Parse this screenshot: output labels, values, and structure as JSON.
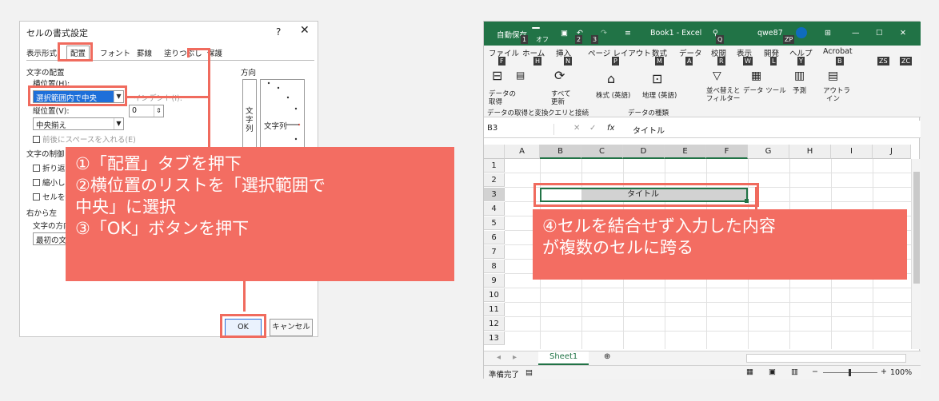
{
  "dialog": {
    "title": "セルの書式設定",
    "help": "?",
    "close": "✕",
    "tabs": [
      "表示形式",
      "配置",
      "フォント",
      "罫線",
      "塗りつぶし",
      "保護"
    ],
    "text_alignment": "文字の配置",
    "horizontal_label": "横位置(H):",
    "horizontal_value": "選択範囲内で中央",
    "indent_label": "インデント(I):",
    "indent_value": "0",
    "vertical_label": "縦位置(V):",
    "vertical_value": "中央揃え",
    "distributed_label": "前後にスペースを入れる(E)",
    "text_control": "文字の制御",
    "wrap": "折り返し",
    "shrink": "縮小して",
    "merge": "セルを結",
    "rtl": "右から左",
    "direction_label": "文字の方向",
    "direction_value": "最初の文字",
    "orientation": "方向",
    "vertical_text": [
      "文",
      "字",
      "列"
    ],
    "orient_text": "文字列",
    "ok": "OK",
    "cancel": "キャンセル"
  },
  "callout_left": {
    "lines": [
      "①「配置」タブを押下",
      "②横位置のリストを「選択範囲で",
      "中央」に選択",
      "③「OK」ボタンを押下"
    ]
  },
  "callout_right": {
    "lines": [
      "④セルを結合せず入力した内容",
      "が複数のセルに跨る"
    ]
  },
  "excel": {
    "autosave": "自動保存",
    "autosave_state": "オフ",
    "title": "Book1  -  Excel",
    "user": "qwe87",
    "keytips": {
      "k1": "1",
      "k2": "2",
      "k3": "3",
      "q": "Q",
      "zp": "ZP",
      "f": "F",
      "h": "H",
      "n": "N",
      "p": "P",
      "m": "M",
      "a": "A",
      "r": "R",
      "w": "W",
      "l": "L",
      "y": "Y",
      "b": "B",
      "zs": "ZS",
      "zc": "ZC"
    },
    "menu": [
      "ファイル",
      "ホーム",
      "挿入",
      "ページ レイアウト",
      "数式",
      "データ",
      "校閲",
      "表示",
      "開発",
      "ヘルプ",
      "Acrobat"
    ],
    "ribbon": {
      "get_data": "データの",
      "get_data2": "取得",
      "refresh": "すべて",
      "refresh2": "更新",
      "stocks": "株式 (英語)",
      "geo": "地理 (英語)",
      "sort": "並べ替えと",
      "sort2": "フィルター",
      "data_tools": "データ ツール",
      "forecast": "予測",
      "outline": "アウトラ",
      "outline2": "イン",
      "group1": "データの取得と変換",
      "group2": "クエリと接続",
      "group3": "データの種類"
    },
    "namebox": "B3",
    "fx": "fx",
    "formula": "タイトル",
    "columns": [
      "A",
      "B",
      "C",
      "D",
      "E",
      "F",
      "G",
      "H",
      "I",
      "J"
    ],
    "rows": [
      "1",
      "2",
      "3",
      "4",
      "5",
      "6",
      "7",
      "8",
      "9",
      "10",
      "11",
      "12",
      "13"
    ],
    "cell_text": "タイトル",
    "sheet": "Sheet1",
    "add_sheet": "⊕",
    "status": "準備完了",
    "zoom": "100%"
  }
}
